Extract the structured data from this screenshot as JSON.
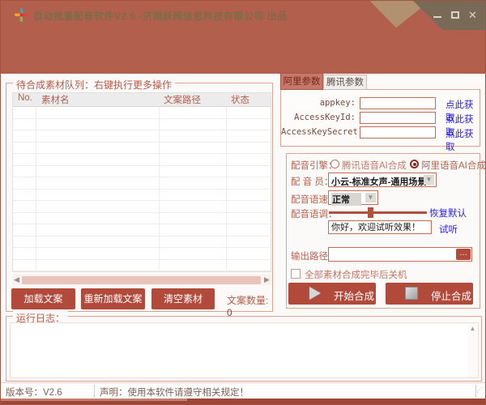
{
  "window": {
    "title": "自动批量配音软件V2.6 -济南跃网信息科技有限公司 出品",
    "icons": {
      "close": "✕",
      "dropdown_arrow": "▼",
      "scroll_left": "◀",
      "scroll_right": "▶",
      "scroll_up": "▲",
      "resize_grip": "⋰"
    }
  },
  "left_panel": {
    "group_title": "待合成素材队列：右键执行更多操作",
    "table": {
      "headers": [
        "No.",
        "素材名",
        "文案路径",
        "状态"
      ],
      "rows": [],
      "visible_empty_rows": 14
    },
    "buttons": {
      "load": "加载文案",
      "reload": "重新加载文案",
      "clear": "清空素材"
    },
    "count_label": "文案数量:",
    "count_value": "0"
  },
  "right_panel": {
    "tabs": [
      {
        "label": "阿里参数",
        "active": true
      },
      {
        "label": "腾讯参数",
        "active": false
      }
    ],
    "params": {
      "fields": [
        {
          "label": "appkey:",
          "value": "",
          "link": "点此获取"
        },
        {
          "label": "AccessKeyId:",
          "value": "",
          "link": "点此获取"
        },
        {
          "label": "AccessKeySecret:",
          "value": "",
          "link": "点此获取"
        }
      ]
    },
    "voice": {
      "engine_label": "配音引擎：",
      "engine_options": [
        {
          "label": "腾讯语音AI合成",
          "selected": false
        },
        {
          "label": "阿里语音AI合成",
          "selected": true
        }
      ],
      "speaker_label": "配 音 员：",
      "speaker_value": "小云-标准女声-通用场景",
      "speed_label": "配音语速：",
      "speed_value": "正常",
      "pitch_label": "配音语调：",
      "pitch_reset_link": "恢复默认",
      "preview_text": "你好，欢迎试听效果！",
      "preview_link": "试听",
      "output_label": "输出路径：",
      "output_value": "",
      "browse_button": "…",
      "shutdown_label": "全部素材合成完毕后关机",
      "start_button": "开始合成",
      "stop_button": "停止合成"
    }
  },
  "log": {
    "group_title": "运行日志："
  },
  "status_bar": {
    "version": "版本号：V2.6",
    "notice": "声明：使用本软件请遵守相关规定！"
  },
  "colors": {
    "titlebar": "#b2604d",
    "accent_button": "#b14a3b",
    "link": "#2a1fd4",
    "tab_active_bg": "#c87868",
    "group_border": "#dca392",
    "slider": "#b0513f"
  }
}
